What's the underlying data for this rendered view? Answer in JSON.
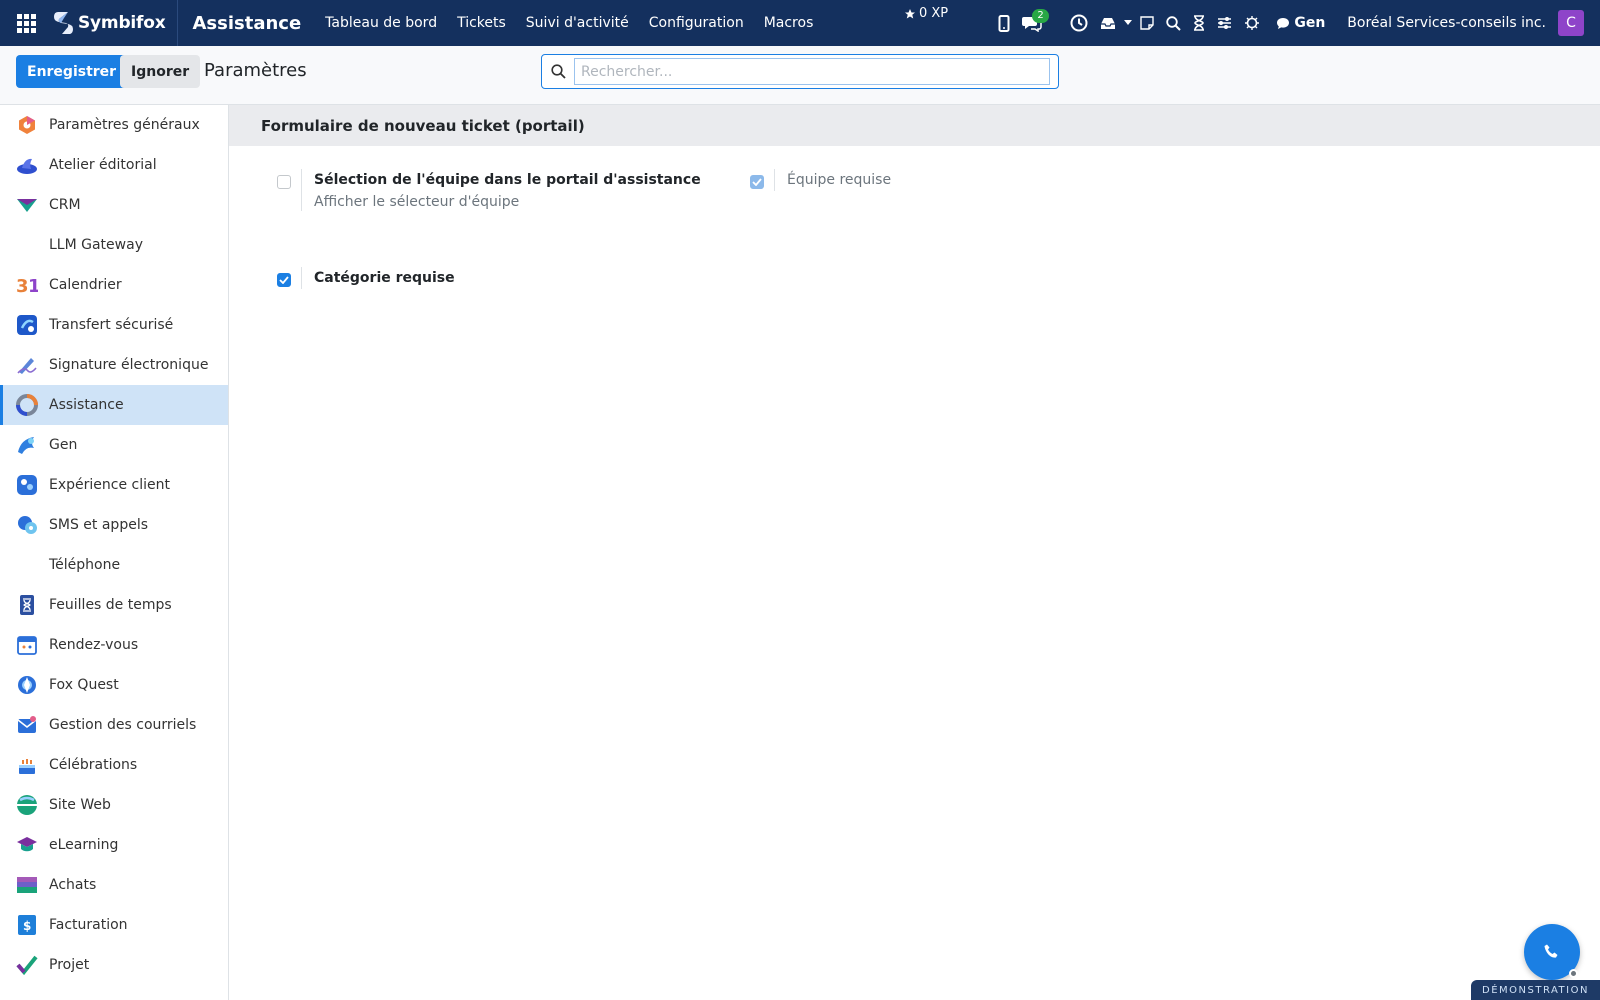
{
  "navbar": {
    "brand": "Symbifox",
    "app_name": "Assistance",
    "menu": [
      "Tableau de bord",
      "Tickets",
      "Suivi d'activité",
      "Configuration",
      "Macros"
    ],
    "xp": "0 XP",
    "messages_badge": "2",
    "gen_label": "Gen",
    "company": "Boréal Services-conseils inc.",
    "avatar_letter": "C"
  },
  "control": {
    "save_label": "Enregistrer",
    "ignore_label": "Ignorer",
    "title": "Paramètres",
    "search_placeholder": "Rechercher..."
  },
  "sidebar": {
    "items": [
      {
        "label": "Paramètres généraux",
        "icon": "settings-hexagon-icon",
        "active": false
      },
      {
        "label": "Atelier éditorial",
        "icon": "editorial-icon",
        "active": false
      },
      {
        "label": "CRM",
        "icon": "crm-icon",
        "active": false
      },
      {
        "label": "LLM Gateway",
        "icon": "",
        "active": false
      },
      {
        "label": "Calendrier",
        "icon": "calendar-icon",
        "active": false
      },
      {
        "label": "Transfert sécurisé",
        "icon": "secure-transfer-icon",
        "active": false
      },
      {
        "label": "Signature électronique",
        "icon": "signature-icon",
        "active": false
      },
      {
        "label": "Assistance",
        "icon": "helpdesk-icon",
        "active": true
      },
      {
        "label": "Gen",
        "icon": "gen-icon",
        "active": false
      },
      {
        "label": "Expérience client",
        "icon": "customer-experience-icon",
        "active": false
      },
      {
        "label": "SMS et appels",
        "icon": "sms-icon",
        "active": false
      },
      {
        "label": "Téléphone",
        "icon": "",
        "active": false
      },
      {
        "label": "Feuilles de temps",
        "icon": "timesheet-icon",
        "active": false
      },
      {
        "label": "Rendez-vous",
        "icon": "appointment-icon",
        "active": false
      },
      {
        "label": "Fox Quest",
        "icon": "quest-icon",
        "active": false
      },
      {
        "label": "Gestion des courriels",
        "icon": "email-icon",
        "active": false
      },
      {
        "label": "Célébrations",
        "icon": "cake-icon",
        "active": false
      },
      {
        "label": "Site Web",
        "icon": "website-icon",
        "active": false
      },
      {
        "label": "eLearning",
        "icon": "elearning-icon",
        "active": false
      },
      {
        "label": "Achats",
        "icon": "purchase-icon",
        "active": false
      },
      {
        "label": "Facturation",
        "icon": "invoice-icon",
        "active": false
      },
      {
        "label": "Projet",
        "icon": "project-icon",
        "active": false
      }
    ]
  },
  "main": {
    "section_title": "Formulaire de nouveau ticket (portail)",
    "settings": [
      {
        "label": "Sélection de l'équipe dans le portail d'assistance",
        "description": "Afficher le sélecteur d'équipe",
        "checked": false
      },
      {
        "label": "Équipe requise",
        "checked": true,
        "disabled": true
      },
      {
        "label": "Catégorie requise",
        "checked": true
      }
    ]
  },
  "footer": {
    "demo_label": "DÉMONSTRATION"
  },
  "colors": {
    "navbar": "#14305e",
    "primary": "#1b7fe3",
    "active_item": "#cfe3f7"
  }
}
